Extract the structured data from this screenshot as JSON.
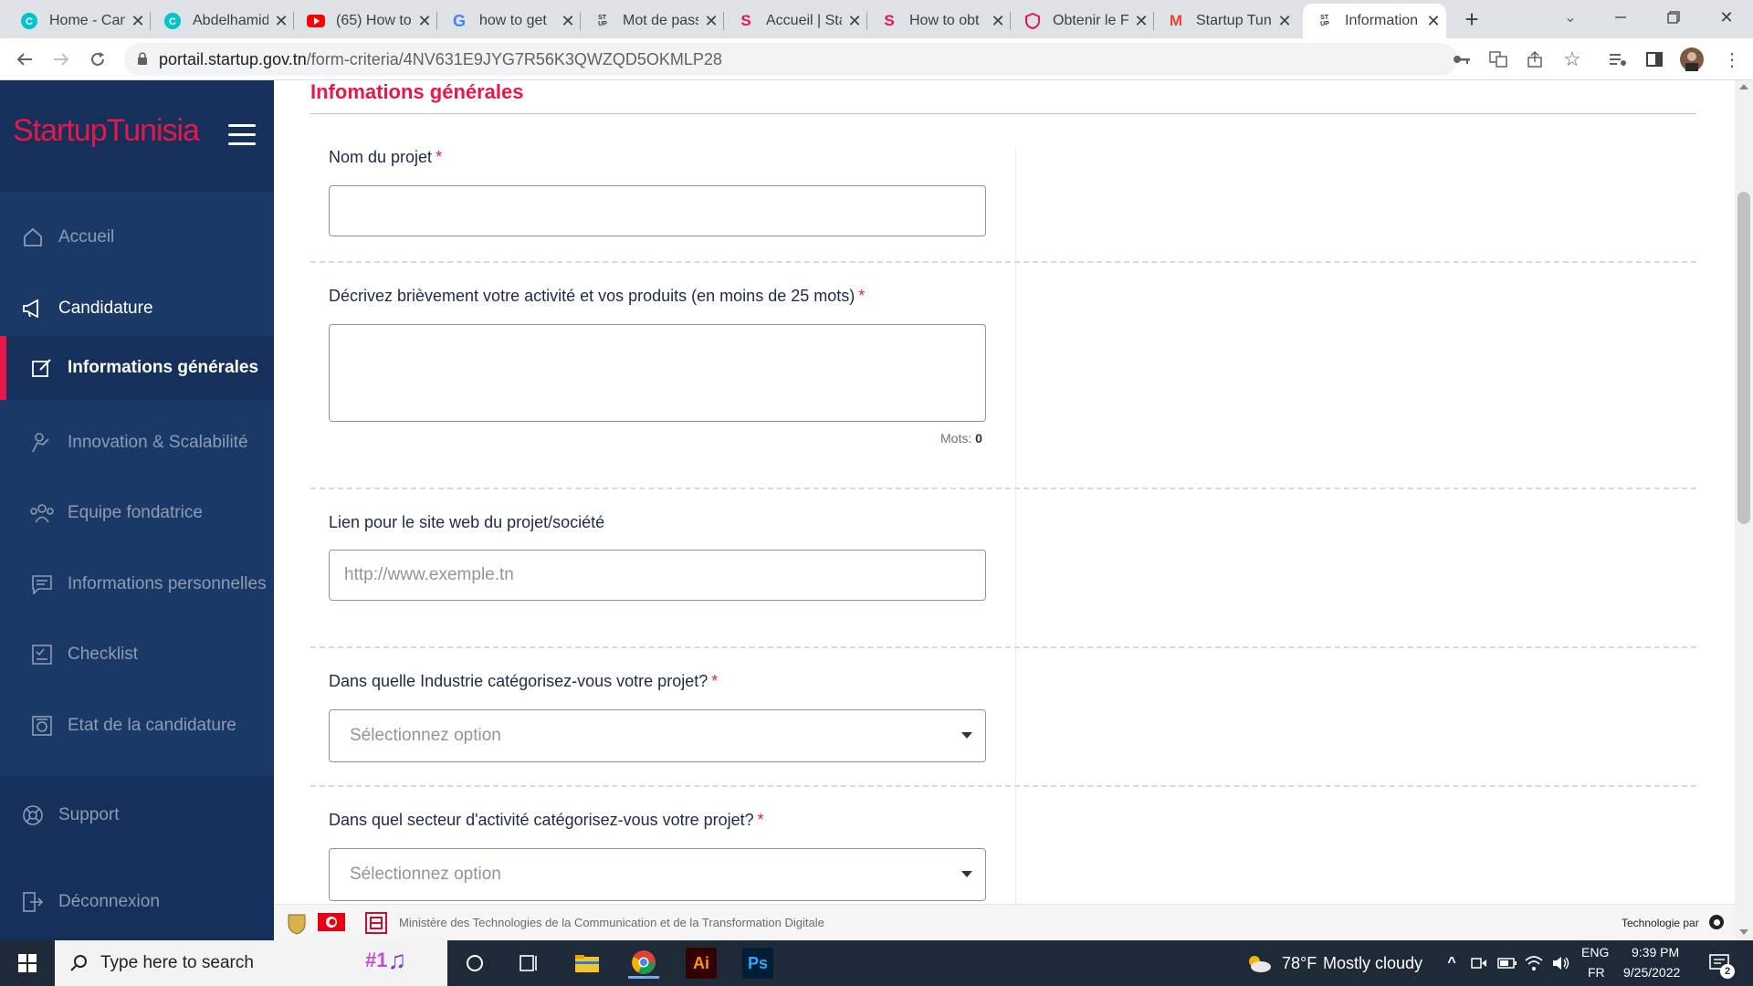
{
  "browser": {
    "tabs": [
      {
        "title": "Home - Canva",
        "icon": "canva-icon",
        "color": "#00c4cc"
      },
      {
        "title": "Abdelhamid",
        "icon": "canva-icon",
        "color": "#00c4cc"
      },
      {
        "title": "(65) How to",
        "icon": "youtube-icon",
        "color": "#ff0000"
      },
      {
        "title": "how to get",
        "icon": "google-icon",
        "color": "#4285f4"
      },
      {
        "title": "Mot de passe",
        "icon": "startup-act-icon",
        "color": "#333333"
      },
      {
        "title": "Accueil | Sta",
        "icon": "startup-tunisia-icon",
        "color": "#e8174a"
      },
      {
        "title": "How to obt",
        "icon": "startup-tunisia-icon",
        "color": "#e8174a"
      },
      {
        "title": "Obtenir le F",
        "icon": "shield-icon",
        "color": "#e8174a"
      },
      {
        "title": "Startup Tun",
        "icon": "gmail-icon",
        "color": "#ea4335"
      },
      {
        "title": "Information",
        "icon": "startup-act-icon",
        "color": "#333333",
        "active": true
      }
    ],
    "url_domain": "portail.startup.gov.tn",
    "url_path": "/form-criteria/4NV631E9JYG7R56K3QWZQD5OKMLP28"
  },
  "sidebar": {
    "brand": "StartupTunisia",
    "items": [
      {
        "label": "Accueil",
        "icon": "home-icon"
      },
      {
        "label": "Candidature",
        "icon": "megaphone-icon"
      },
      {
        "label": "Informations générales",
        "icon": "edit-icon"
      },
      {
        "label": "Innovation & Scalabilité",
        "icon": "innovation-icon"
      },
      {
        "label": "Equipe fondatrice",
        "icon": "team-icon"
      },
      {
        "label": "Informations personnelles",
        "icon": "chat-icon"
      },
      {
        "label": "Checklist",
        "icon": "checklist-icon"
      },
      {
        "label": "Etat de la candidature",
        "icon": "status-icon"
      },
      {
        "label": "Support",
        "icon": "support-icon"
      },
      {
        "label": "Déconnexion",
        "icon": "logout-icon"
      }
    ]
  },
  "form": {
    "section_title": "Infomations générales",
    "project_name_label": "Nom du projet",
    "description_label": "Décrivez brièvement votre activité et vos produits (en moins de 25 mots)",
    "word_count_label": "Mots:",
    "word_count_value": "0",
    "website_label": "Lien pour le site web du projet/société",
    "website_placeholder": "http://www.exemple.tn",
    "industry_label": "Dans quelle Industrie catégorisez-vous votre projet?",
    "industry_placeholder": "Sélectionnez option",
    "sector_label": "Dans quel secteur d'activité catégorisez-vous votre projet?",
    "sector_placeholder": "Sélectionnez option",
    "required_mark": "*"
  },
  "footer": {
    "ministry": "Ministère des Technologies de la Communication et de la Transformation Digitale",
    "tech_by": "Technologie par"
  },
  "taskbar": {
    "search_placeholder": "Type here to search",
    "weather_temp": "78°F",
    "weather_text": "Mostly cloudy",
    "lang_top": "ENG",
    "lang_bottom": "FR",
    "time": "9:39 PM",
    "date": "9/25/2022",
    "notifications": "2",
    "badge": "#1"
  }
}
